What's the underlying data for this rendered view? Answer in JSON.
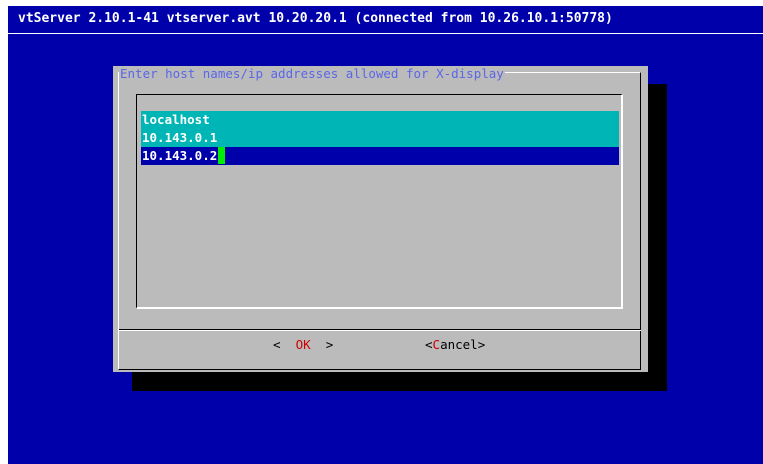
{
  "screen": {
    "title": "vtServer 2.10.1-41 vtserver.avt 10.20.20.1 (connected from 10.26.10.1:50778)"
  },
  "dialog": {
    "title": "Enter host names/ip addresses allowed for X-display",
    "entries": [
      "localhost",
      "10.143.0.1",
      "10.143.0.2"
    ],
    "buttons": {
      "ok_left": "<  ",
      "ok_label": "OK",
      "ok_right": "  >",
      "cancel_left": "<",
      "cancel_hot": "C",
      "cancel_rest": "ancel>"
    }
  },
  "colors": {
    "background": "#0000aa",
    "dialog": "#bbbbbb",
    "selected_row": "#00b5b5",
    "cursor": "#00ee00"
  }
}
